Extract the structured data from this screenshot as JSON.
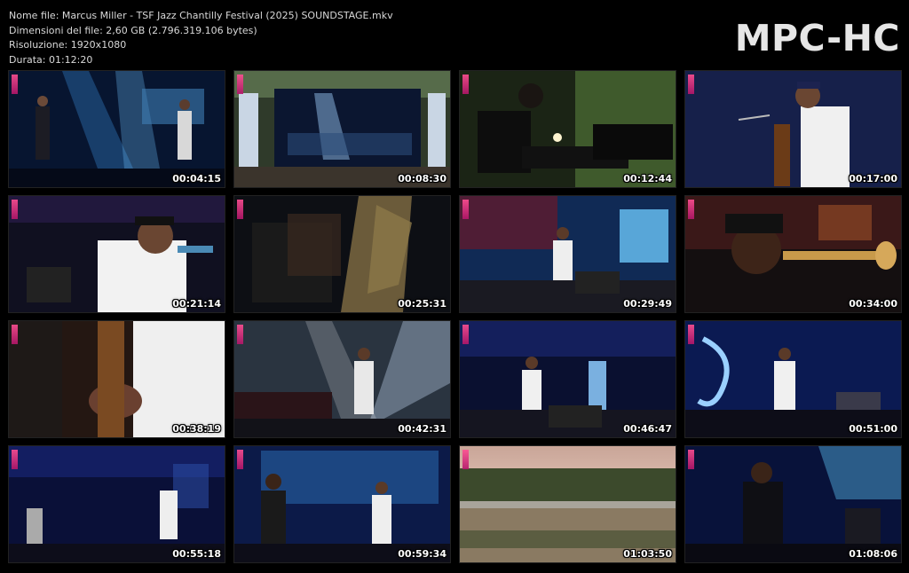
{
  "file_info": {
    "name_line": "Nome file: Marcus Miller - TSF Jazz Chantilly Festival (2025) SOUNDSTAGE.mkv",
    "size_line": "Dimensioni del file: 2,60 GB (2.796.319.106 bytes)",
    "resolution_line": "Risoluzione: 1920x1080",
    "duration_line": "Durata: 01:12:20"
  },
  "brand": "MPC-HC",
  "thumbnails": [
    {
      "time": "00:04:15",
      "scene": "stage-wide-blue"
    },
    {
      "time": "00:08:30",
      "scene": "stage-crowd"
    },
    {
      "time": "00:12:44",
      "scene": "keyboard-player"
    },
    {
      "time": "00:17:00",
      "scene": "bassist-closeup"
    },
    {
      "time": "00:21:14",
      "scene": "singer-closeup"
    },
    {
      "time": "00:25:31",
      "scene": "sax-closeup"
    },
    {
      "time": "00:29:49",
      "scene": "two-bassists-red"
    },
    {
      "time": "00:34:00",
      "scene": "trumpet-closeup"
    },
    {
      "time": "00:38:19",
      "scene": "hands-closeup"
    },
    {
      "time": "00:42:31",
      "scene": "bassist-stage-lights"
    },
    {
      "time": "00:46:47",
      "scene": "band-blue-stage"
    },
    {
      "time": "00:51:00",
      "scene": "sax-screen-blue"
    },
    {
      "time": "00:55:18",
      "scene": "band-wide-dark"
    },
    {
      "time": "00:59:34",
      "scene": "sax-bass-stage"
    },
    {
      "time": "01:03:50",
      "scene": "park-pond"
    },
    {
      "time": "01:08:06",
      "scene": "sax-player-dark"
    }
  ],
  "colors": {
    "background": "#000000",
    "info_text": "#d8d8d8",
    "brand_text": "#e6e6e6",
    "timestamp": "#ffffff"
  }
}
